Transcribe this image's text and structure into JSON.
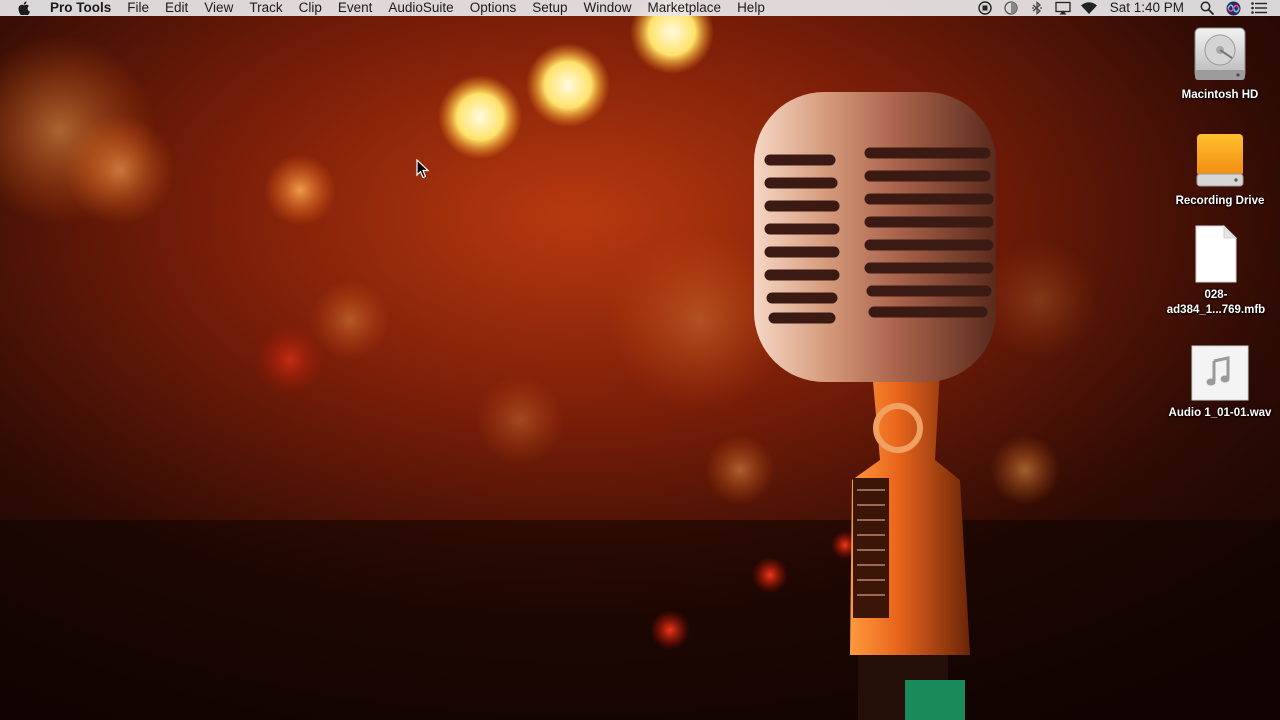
{
  "menubar": {
    "apple_icon": "apple-icon",
    "app_name": "Pro Tools",
    "menus": [
      "File",
      "Edit",
      "View",
      "Track",
      "Clip",
      "Event",
      "AudioSuite",
      "Options",
      "Setup",
      "Window",
      "Marketplace",
      "Help"
    ],
    "status_icons": [
      "record-icon",
      "display-icon",
      "bluetooth-icon",
      "airplay-icon",
      "wifi-icon"
    ],
    "clock": "Sat 1:40 PM",
    "right_icons": [
      "spotlight-icon",
      "siri-icon",
      "notification-center-icon"
    ]
  },
  "desktop": {
    "wallpaper": "microphone-bokeh-wallpaper",
    "icons": [
      {
        "label": "Macintosh HD",
        "icon": "hard-drive-icon"
      },
      {
        "label": "Recording Drive",
        "icon": "external-drive-icon"
      },
      {
        "label": "028-\nad384_1...769.mfb",
        "icon": "document-icon"
      },
      {
        "label": "Audio 1_01-01.wav",
        "icon": "audio-file-icon"
      }
    ]
  },
  "colors": {
    "menubar_bg": "#e8e6e8",
    "ext_drive": "#f5a623",
    "wallpaper_glow": "#e8561a"
  }
}
